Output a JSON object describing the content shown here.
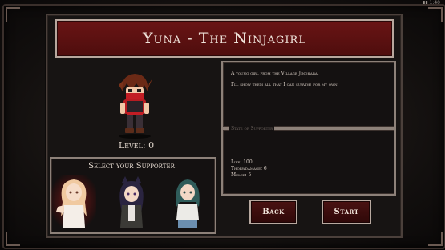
{
  "status_bar": {
    "text": "▮▮ 1:40"
  },
  "title": "Yuna - The Ninjagirl",
  "hero": {
    "level_label": "Level: 0"
  },
  "description": {
    "line1": "A young girl from the Village Jinohara.",
    "line2": "I'll show them all that I can survive for my own."
  },
  "stats": {
    "header": "Stats of Supporter",
    "life": "Life: 100",
    "throw_damage": "Thorwdamage: 6",
    "melee": "Melee: 5"
  },
  "supporter": {
    "title": "Select your Supporter",
    "characters": [
      "blonde-girl",
      "dark-haired-catgirl",
      "teal-haired-girl"
    ],
    "selected_index": 0
  },
  "buttons": {
    "back": "Back",
    "start": "Start"
  },
  "colors": {
    "banner": "#5a1010",
    "button": "#3d0e0e",
    "border": "#b8a9a0",
    "selection_glow": "#c81e1e"
  }
}
